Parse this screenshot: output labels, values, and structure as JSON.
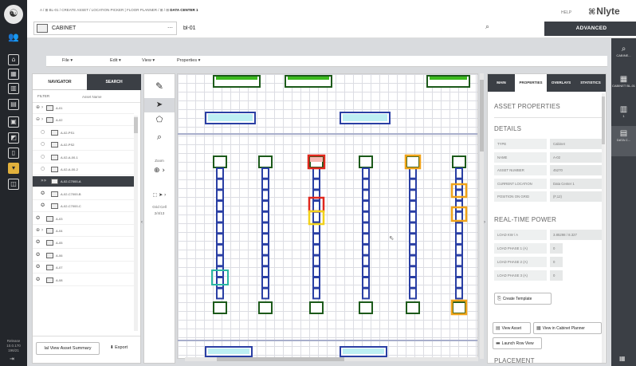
{
  "topbar": {
    "crumbs": "A / ⊞ BL-01 / CREATE ASSET / LOCATION PICKER | FLOOR PLANNER / ⊞ / ⊞",
    "crumb_current": "DATA CENTER 1",
    "help": "HELP",
    "brand": "Nlyte",
    "type_value": "CABINET",
    "name_value": "bl-01",
    "advanced_label": "ADVANCED"
  },
  "menu": {
    "file": "File ▾",
    "edit": "Edit ▾",
    "view": "View ▾",
    "properties": "Properties ▾"
  },
  "navigator": {
    "tab_navigator": "NAVIGATOR",
    "tab_search": "SEARCH",
    "filter_label": "FILTER",
    "filter_placeholder": "Asset Name",
    "items": [
      {
        "prefix": "⊕ ›",
        "label": "A-01"
      },
      {
        "prefix": "⊖ ›",
        "label": "A-02"
      },
      {
        "prefix": "○",
        "label": "A-02-PS1"
      },
      {
        "prefix": "○",
        "label": "A-02-PS2"
      },
      {
        "prefix": "○",
        "label": "A-02-A-00-1"
      },
      {
        "prefix": "○",
        "label": "A-02-A-00-2"
      },
      {
        "prefix": "»»",
        "label": "A-02-C7000-A"
      },
      {
        "prefix": "✪",
        "label": "A-02-C7000-B"
      },
      {
        "prefix": "✪",
        "label": "A-02-C7000-C"
      },
      {
        "prefix": "✪",
        "label": "A-03"
      },
      {
        "prefix": "⊕ ›",
        "label": "A-04"
      },
      {
        "prefix": "✪",
        "label": "A-05"
      },
      {
        "prefix": "✪",
        "label": "A-06"
      },
      {
        "prefix": "✪",
        "label": "A-07"
      },
      {
        "prefix": "✪",
        "label": "A-08"
      }
    ],
    "view_summary": "lal View Asset Summary",
    "export": "⬇ Export"
  },
  "tools": {
    "zoom_label": "Zoom",
    "grid_cell_label": "Grid Cell",
    "grid_cell_value": "2/4/13"
  },
  "properties": {
    "tabs": [
      "MAIN",
      "PROPERTIES",
      "OVERLAYS",
      "STATISTICS"
    ],
    "asset_properties": "ASSET PROPERTIES",
    "details": "DETAILS",
    "detail_rows": [
      {
        "k": "TYPE",
        "v": "Cabinet"
      },
      {
        "k": "NAME",
        "v": "A-02"
      },
      {
        "k": "ASSET NUMBER",
        "v": "45270"
      },
      {
        "k": "CURRENT LOCATION",
        "v": "Data Center 1"
      },
      {
        "k": "POSITION ON GRID",
        "v": "(F,12)"
      }
    ],
    "realtime_power": "REAL-TIME POWER",
    "power_rows": [
      {
        "k": "LOAD KW / A",
        "v": "3.85298 / 8.327"
      },
      {
        "k": "LOAD PHASE 1 (A)",
        "v": "0"
      },
      {
        "k": "LOAD PHASE 2 (A)",
        "v": "0"
      },
      {
        "k": "LOAD PHASE 3 (A)",
        "v": "0"
      }
    ],
    "create_template": "Create Template",
    "view_asset": "View Asset",
    "view_in_cabinet_planner": "View in Cabinet Planner",
    "launch_row_view": "Launch Row View",
    "placement": "PLACEMENT"
  },
  "rightrail": {
    "items": [
      {
        "glyph": "⌕",
        "label": "CABINE..."
      },
      {
        "glyph": "▦",
        "label": "CABINET BL-01"
      },
      {
        "glyph": "▥",
        "label": "1"
      },
      {
        "glyph": "▤",
        "label": "DATA C..."
      }
    ]
  },
  "leftrail": {
    "version": "Release 10.0.170 196/21"
  },
  "colors": {
    "dark": "#3b3f45",
    "rail": "#23262b",
    "cabinet_blue": "#2a3fa4",
    "cabinet_green": "#3dba1f",
    "alert_red": "#e0281e",
    "alert_orange": "#f0a319",
    "alert_yellow": "#f2d21b",
    "teal": "#2bb7a3"
  }
}
